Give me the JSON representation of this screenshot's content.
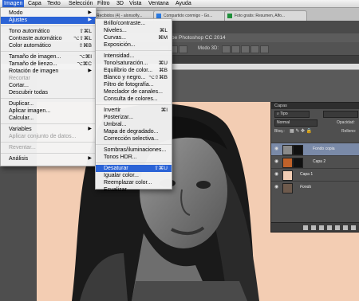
{
  "menubar": {
    "items": [
      "Imagen",
      "Capa",
      "Texto",
      "Selección",
      "Filtro",
      "3D",
      "Vista",
      "Ventana",
      "Ayuda"
    ]
  },
  "browser_tabs": [
    "Recibidos (4) - alonsofly...",
    "Compartido conmigo - Go...",
    "Foto gratis: Resumen, Alfo..."
  ],
  "app_title": "be Photoshop CC 2014",
  "options": {
    "mode3d": "Modo 3D:"
  },
  "image_menu": [
    {
      "label": "Modo",
      "arrow": true
    },
    {
      "label": "Ajustes",
      "arrow": true,
      "highlight": true
    },
    {
      "sep": true
    },
    {
      "label": "Tono automático",
      "key": "⇧⌘L"
    },
    {
      "label": "Contraste automático",
      "key": "⌥⇧⌘L"
    },
    {
      "label": "Color automático",
      "key": "⇧⌘B"
    },
    {
      "sep": true
    },
    {
      "label": "Tamaño de imagen...",
      "key": "⌥⌘I"
    },
    {
      "label": "Tamaño de lienzo...",
      "key": "⌥⌘C"
    },
    {
      "label": "Rotación de imagen",
      "arrow": true
    },
    {
      "label": "Recortar",
      "disabled": true
    },
    {
      "label": "Cortar..."
    },
    {
      "label": "Descubrir todas"
    },
    {
      "sep": true
    },
    {
      "label": "Duplicar..."
    },
    {
      "label": "Aplicar imagen..."
    },
    {
      "label": "Calcular..."
    },
    {
      "sep": true
    },
    {
      "label": "Variables",
      "arrow": true
    },
    {
      "label": "Aplicar conjunto de datos...",
      "disabled": true
    },
    {
      "sep": true
    },
    {
      "label": "Reventar...",
      "disabled": true
    },
    {
      "sep": true
    },
    {
      "label": "Análisis",
      "arrow": true
    }
  ],
  "adjust_menu": [
    {
      "label": "Brillo/contraste..."
    },
    {
      "label": "Niveles...",
      "key": "⌘L"
    },
    {
      "label": "Curvas...",
      "key": "⌘M"
    },
    {
      "label": "Exposición..."
    },
    {
      "sep": true
    },
    {
      "label": "Intensidad..."
    },
    {
      "label": "Tono/saturación...",
      "key": "⌘U"
    },
    {
      "label": "Equilibrio de color...",
      "key": "⌘B"
    },
    {
      "label": "Blanco y negro...",
      "key": "⌥⇧⌘B"
    },
    {
      "label": "Filtro de fotografía..."
    },
    {
      "label": "Mezclador de canales..."
    },
    {
      "label": "Consulta de colores..."
    },
    {
      "sep": true
    },
    {
      "label": "Invertir",
      "key": "⌘I"
    },
    {
      "label": "Posterizar..."
    },
    {
      "label": "Umbral..."
    },
    {
      "label": "Mapa de degradado..."
    },
    {
      "label": "Corrección selectiva..."
    },
    {
      "sep": true
    },
    {
      "label": "Sombras/iluminaciones..."
    },
    {
      "label": "Tonos HDR..."
    },
    {
      "sep": true
    },
    {
      "label": "Desaturar",
      "key": "⇧⌘U",
      "highlight": true
    },
    {
      "label": "Igualar color..."
    },
    {
      "label": "Reemplazar color..."
    },
    {
      "label": "Ecualizar"
    }
  ],
  "layers_panel": {
    "title": "Capas",
    "kind_filter": "Tipo",
    "blend_mode": "Normal",
    "opacity_label": "Opacidad:",
    "lock_label": "Bloq.:",
    "fill_label": "Relleno:",
    "layers": [
      {
        "name": "Fondo copia",
        "selected": true,
        "thumb_color": "#8a8a8a",
        "mask": true
      },
      {
        "name": "Capa 2",
        "selected": false,
        "thumb_color": "#c0622a",
        "mask": true
      },
      {
        "name": "Capa 1",
        "selected": false,
        "thumb_color": "#f1cdb4",
        "mask": false
      },
      {
        "name": "Fondo",
        "selected": false,
        "thumb_color": "#6e5a4c",
        "mask": false,
        "italic": true
      }
    ]
  },
  "colors": {
    "menu_highlight": "#2b63d6",
    "canvas_peach": "#f3cdb3"
  }
}
